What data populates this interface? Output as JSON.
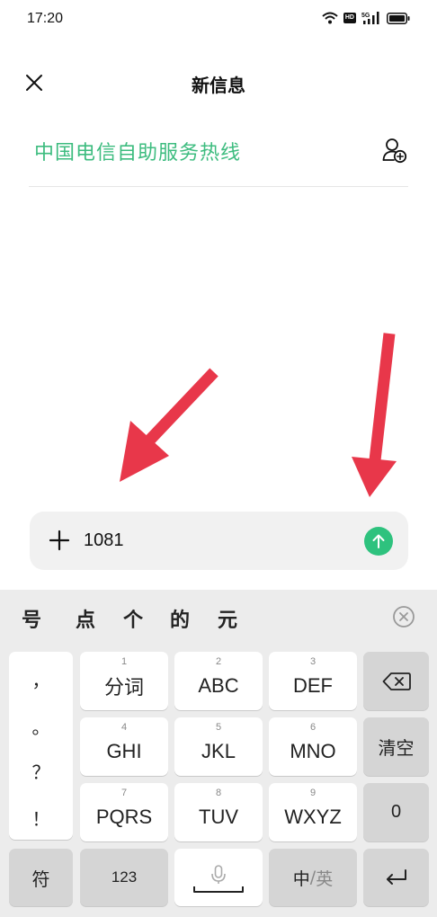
{
  "status_bar": {
    "time": "17:20",
    "hd_label": "HD",
    "network_label": "5G"
  },
  "header": {
    "title": "新信息"
  },
  "recipient": {
    "name": "中国电信自助服务热线"
  },
  "compose": {
    "text": "1081"
  },
  "keyboard": {
    "candidates": [
      "号",
      "点",
      "个",
      "的",
      "元"
    ],
    "punctuation": [
      "，",
      "。",
      "？",
      "！"
    ],
    "keys": [
      {
        "num": "1",
        "label": "分词"
      },
      {
        "num": "2",
        "label": "ABC"
      },
      {
        "num": "3",
        "label": "DEF"
      },
      {
        "num": "4",
        "label": "GHI"
      },
      {
        "num": "5",
        "label": "JKL"
      },
      {
        "num": "6",
        "label": "MNO"
      },
      {
        "num": "7",
        "label": "PQRS"
      },
      {
        "num": "8",
        "label": "TUV"
      },
      {
        "num": "9",
        "label": "WXYZ"
      }
    ],
    "clear_label": "清空",
    "zero_label": "0",
    "symbol_label": "符",
    "numeric_label": "123",
    "lang_zh": "中",
    "lang_sep": "/",
    "lang_en": "英"
  },
  "colors": {
    "accent": "#3dbc7f",
    "send_button": "#2ec27e",
    "arrow": "#e8374a"
  },
  "icons": [
    "close-icon",
    "add-contact-icon",
    "plus-icon",
    "send-arrow-icon",
    "clear-candidates-icon",
    "backspace-icon",
    "microphone-icon",
    "return-icon"
  ]
}
